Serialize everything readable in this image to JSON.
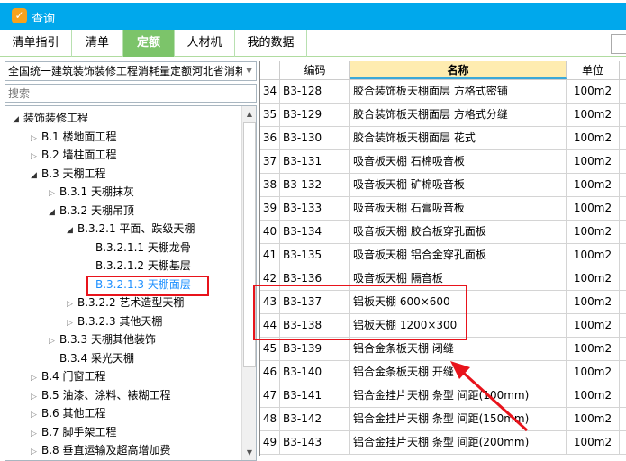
{
  "window": {
    "title": "查询",
    "logo_glyph": "✓"
  },
  "tabs": [
    {
      "label": "清单指引"
    },
    {
      "label": "清单"
    },
    {
      "label": "定额",
      "active": true
    },
    {
      "label": "人材机"
    },
    {
      "label": "我的数据"
    }
  ],
  "left": {
    "dropdown_value": "全国统一建筑装饰装修工程消耗量定额河北省消耗",
    "search_placeholder": "搜索",
    "tree": [
      {
        "label": "装饰装修工程",
        "level": 0,
        "state": "open"
      },
      {
        "label": "B.1 楼地面工程",
        "level": 1,
        "state": "closed"
      },
      {
        "label": "B.2 墙柱面工程",
        "level": 1,
        "state": "closed"
      },
      {
        "label": "B.3 天棚工程",
        "level": 1,
        "state": "open"
      },
      {
        "label": "B.3.1 天棚抹灰",
        "level": 2,
        "state": "closed"
      },
      {
        "label": "B.3.2 天棚吊顶",
        "level": 2,
        "state": "open"
      },
      {
        "label": "B.3.2.1 平面、跌级天棚",
        "level": 3,
        "state": "open"
      },
      {
        "label": "B.3.2.1.1 天棚龙骨",
        "level": 4,
        "state": "leaf"
      },
      {
        "label": "B.3.2.1.2 天棚基层",
        "level": 4,
        "state": "leaf"
      },
      {
        "label": "B.3.2.1.3 天棚面层",
        "level": 4,
        "state": "leaf",
        "selected": true
      },
      {
        "label": "B.3.2.2 艺术造型天棚",
        "level": 3,
        "state": "closed"
      },
      {
        "label": "B.3.2.3 其他天棚",
        "level": 3,
        "state": "closed"
      },
      {
        "label": "B.3.3 天棚其他装饰",
        "level": 2,
        "state": "closed"
      },
      {
        "label": "B.3.4 采光天棚",
        "level": 2,
        "state": "leaf"
      },
      {
        "label": "B.4 门窗工程",
        "level": 1,
        "state": "closed"
      },
      {
        "label": "B.5 油漆、涂料、裱糊工程",
        "level": 1,
        "state": "closed"
      },
      {
        "label": "B.6 其他工程",
        "level": 1,
        "state": "closed"
      },
      {
        "label": "B.7 脚手架工程",
        "level": 1,
        "state": "closed"
      },
      {
        "label": "B.8 垂直运输及超高增加费",
        "level": 1,
        "state": "closed"
      }
    ]
  },
  "table": {
    "headers": {
      "code": "编码",
      "name": "名称",
      "unit": "单位"
    },
    "rows": [
      {
        "n": "34",
        "code": "B3-128",
        "name": "胶合装饰板天棚面层 方格式密铺",
        "unit": "100m2"
      },
      {
        "n": "35",
        "code": "B3-129",
        "name": "胶合装饰板天棚面层 方格式分缝",
        "unit": "100m2"
      },
      {
        "n": "36",
        "code": "B3-130",
        "name": "胶合装饰板天棚面层 花式",
        "unit": "100m2"
      },
      {
        "n": "37",
        "code": "B3-131",
        "name": "吸音板天棚 石棉吸音板",
        "unit": "100m2"
      },
      {
        "n": "38",
        "code": "B3-132",
        "name": "吸音板天棚 矿棉吸音板",
        "unit": "100m2"
      },
      {
        "n": "39",
        "code": "B3-133",
        "name": "吸音板天棚 石膏吸音板",
        "unit": "100m2"
      },
      {
        "n": "40",
        "code": "B3-134",
        "name": "吸音板天棚 胶合板穿孔面板",
        "unit": "100m2"
      },
      {
        "n": "41",
        "code": "B3-135",
        "name": "吸音板天棚 铝合金穿孔面板",
        "unit": "100m2"
      },
      {
        "n": "42",
        "code": "B3-136",
        "name": "吸音板天棚 隔音板",
        "unit": "100m2"
      },
      {
        "n": "43",
        "code": "B3-137",
        "name": "铝板天棚 600×600",
        "unit": "100m2"
      },
      {
        "n": "44",
        "code": "B3-138",
        "name": "铝板天棚 1200×300",
        "unit": "100m2"
      },
      {
        "n": "45",
        "code": "B3-139",
        "name": "铝合金条板天棚 闭缝",
        "unit": "100m2"
      },
      {
        "n": "46",
        "code": "B3-140",
        "name": "铝合金条板天棚 开缝",
        "unit": "100m2"
      },
      {
        "n": "47",
        "code": "B3-141",
        "name": "铝合金挂片天棚 条型 间距(100mm)",
        "unit": "100m2"
      },
      {
        "n": "48",
        "code": "B3-142",
        "name": "铝合金挂片天棚 条型 间距(150mm)",
        "unit": "100m2"
      },
      {
        "n": "49",
        "code": "B3-143",
        "name": "铝合金挂片天棚 条型 间距(200mm)",
        "unit": "100m2"
      }
    ]
  },
  "colors": {
    "titlebar": "#00a8ec",
    "active_tab": "#7cc46a",
    "highlight": "#e8131b",
    "selected_node": "#1e90ff"
  }
}
